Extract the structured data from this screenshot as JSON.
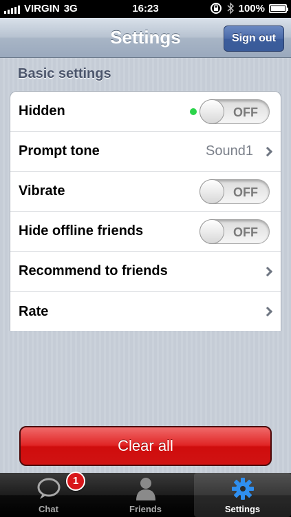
{
  "status_bar": {
    "carrier": "VIRGIN",
    "network": "3G",
    "time": "16:23",
    "battery": "100%"
  },
  "nav": {
    "title": "Settings",
    "sign_out_label": "Sign out"
  },
  "section_header": "Basic settings",
  "settings": [
    {
      "label": "Hidden",
      "control": "toggle",
      "state": "OFF",
      "indicator": "online"
    },
    {
      "label": "Prompt tone",
      "control": "disclosure",
      "value": "Sound1"
    },
    {
      "label": "Vibrate",
      "control": "toggle",
      "state": "OFF"
    },
    {
      "label": "Hide offline friends",
      "control": "toggle",
      "state": "OFF"
    },
    {
      "label": "Recommend to friends",
      "control": "disclosure"
    },
    {
      "label": "Rate",
      "control": "disclosure"
    }
  ],
  "clear_all_label": "Clear all",
  "tabs": [
    {
      "label": "Chat",
      "icon": "chat-bubble-icon",
      "badge": "1"
    },
    {
      "label": "Friends",
      "icon": "person-icon"
    },
    {
      "label": "Settings",
      "icon": "gear-icon",
      "active": true
    }
  ],
  "colors": {
    "accent_blue": "#3b5c9c",
    "danger_red": "#d11313",
    "online_green": "#2bd44a",
    "badge_red": "#d8161a"
  }
}
